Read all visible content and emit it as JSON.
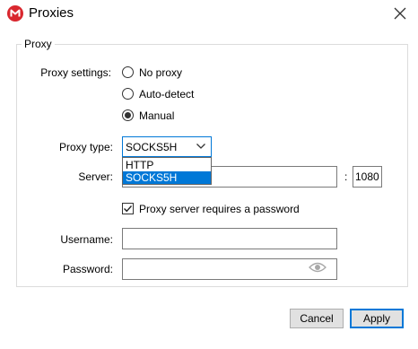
{
  "window": {
    "title": "Proxies",
    "icon": "mega-logo-icon",
    "close_icon": "close-icon"
  },
  "group": {
    "legend": "Proxy"
  },
  "proxy_settings": {
    "label": "Proxy settings:",
    "options": [
      {
        "label": "No proxy",
        "selected": false
      },
      {
        "label": "Auto-detect",
        "selected": false
      },
      {
        "label": "Manual",
        "selected": true
      }
    ]
  },
  "proxy_type": {
    "label": "Proxy type:",
    "value": "SOCKS5H",
    "options": [
      {
        "label": "HTTP",
        "highlighted": false
      },
      {
        "label": "SOCKS5H",
        "highlighted": true
      }
    ]
  },
  "server": {
    "label": "Server:",
    "value": "",
    "separator": ":",
    "port": "1080"
  },
  "auth": {
    "checkbox_label": "Proxy server requires a password",
    "checked": true
  },
  "username": {
    "label": "Username:",
    "value": ""
  },
  "password": {
    "label": "Password:",
    "value": "",
    "icon": "eye-icon"
  },
  "buttons": {
    "cancel": "Cancel",
    "apply": "Apply"
  },
  "colors": {
    "accent": "#0078d7",
    "brand": "#d9272e"
  }
}
